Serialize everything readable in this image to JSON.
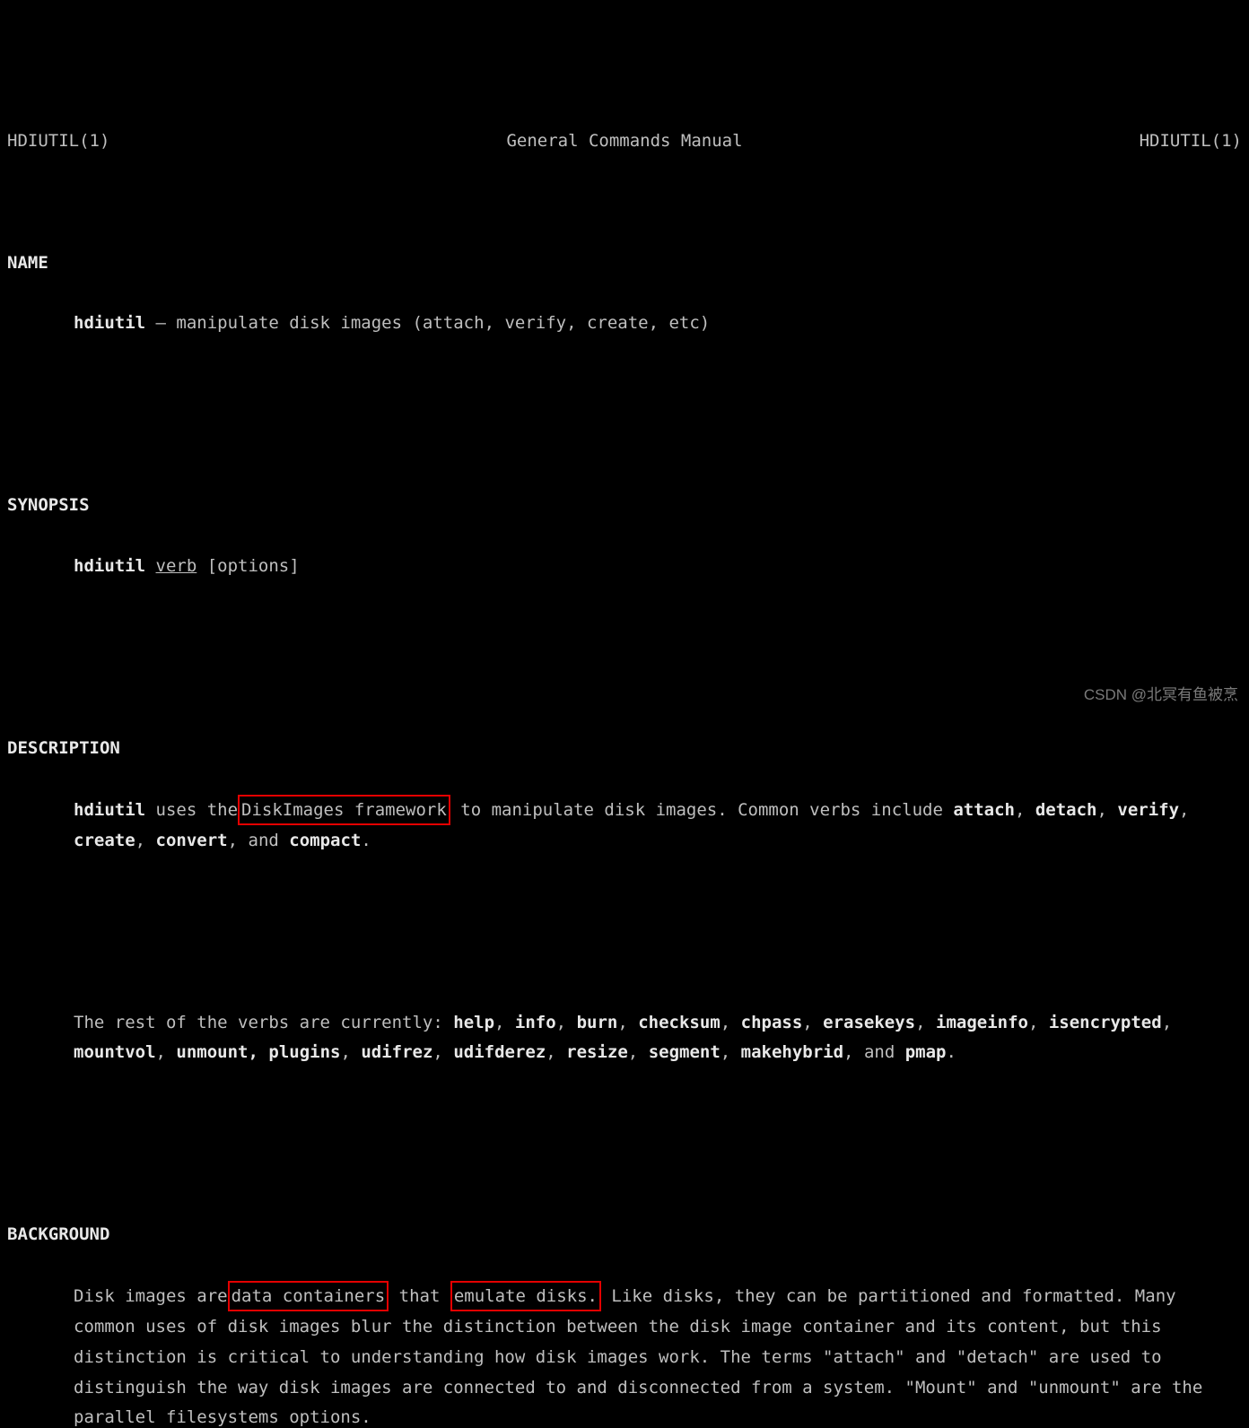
{
  "header": {
    "left": "HDIUTIL(1)",
    "center": "General Commands Manual",
    "right": "HDIUTIL(1)"
  },
  "name_head": "NAME",
  "name_cmd": "hdiutil",
  "name_desc": " – manipulate disk images (attach, verify, create, etc)",
  "syn_head": "SYNOPSIS",
  "syn_cmd": "hdiutil",
  "syn_verb": "verb",
  "syn_opts": " [options]",
  "desc_head": "DESCRIPTION",
  "desc_cmd": "hdiutil",
  "desc_p1a": " uses the",
  "desc_hl1": " DiskImages framework",
  "desc_p1b": " to manipulate disk images.  Common verbs include ",
  "verbs1": {
    "attach": "attach",
    "detach": "detach",
    "verify": "verify",
    "create": "create",
    "convert": "convert",
    "compact": "compact"
  },
  "and": "and ",
  "comma": ", ",
  "period": ".",
  "desc_p2a": "The rest of the verbs are currently: ",
  "verbs2a": {
    "help": "help",
    "info": "info",
    "burn": "burn",
    "checksum": "checksum",
    "chpass": "chpass",
    "erasekeys": "erasekeys"
  },
  "verbs2b": {
    "imageinfo": "imageinfo",
    "isencrypted": "isencrypted",
    "mountvol": "mountvol",
    "unmount": "unmount,",
    "plugins": "plugins",
    "udifrez": "udifrez",
    "udifderez": "udifderez",
    "resize": "resize",
    "segment": "segment"
  },
  "verbs2c": {
    "makehybrid": "makehybrid",
    "pmap": "pmap"
  },
  "bg_head": "BACKGROUND",
  "bg_p1a": "Disk images are",
  "bg_hl1": " data containers",
  "bg_p1b": " that ",
  "bg_hl2": "emulate disks.",
  "bg_p1c": "  Like disks, they can be partitioned and formatted.  Many common uses of disk images blur the distinction between the disk image container and its content, but this distinction is critical to understanding how disk images work.  The terms \"attach\" and \"detach\" are used to distinguish the way disk images are connected to and disconnected from a system.  \"Mount\" and \"unmount\" are the parallel filesystems options.",
  "watermark": "CSDN @北冥有鱼被烹"
}
